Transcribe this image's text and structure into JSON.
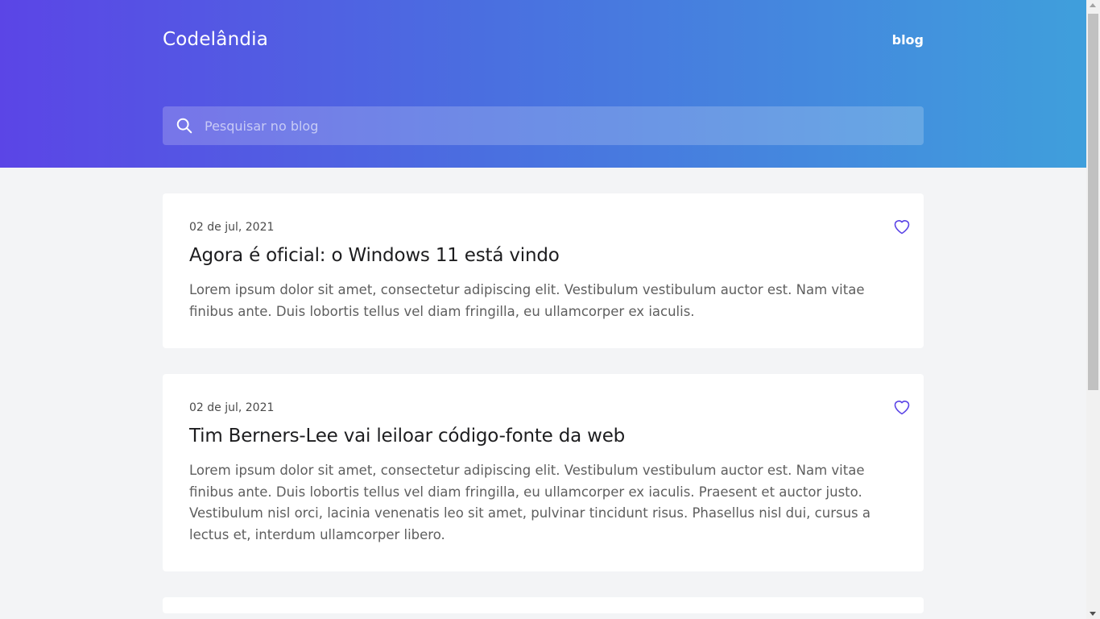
{
  "header": {
    "logo": "Codelândia",
    "nav_link": "blog",
    "search_placeholder": "Pesquisar no blog"
  },
  "posts": [
    {
      "date": "02 de jul, 2021",
      "title": "Agora é oficial: o Windows 11 está vindo",
      "body": "Lorem ipsum dolor sit amet, consectetur adipiscing elit. Vestibulum vestibulum auctor est. Nam vitae finibus ante. Duis lobortis tellus vel diam fringilla, eu ullamcorper ex iaculis."
    },
    {
      "date": "02 de jul, 2021",
      "title": "Tim Berners-Lee vai leiloar código-fonte da web",
      "body": "Lorem ipsum dolor sit amet, consectetur adipiscing elit. Vestibulum vestibulum auctor est. Nam vitae finibus ante. Duis lobortis tellus vel diam fringilla, eu ullamcorper ex iaculis. Praesent et auctor justo. Vestibulum nisl orci, lacinia venenatis leo sit amet, pulvinar tincidunt risus. Phasellus nisl dui, cursus a lectus et, interdum ullamcorper libero."
    }
  ],
  "icons": {
    "search": "search-icon",
    "like": "heart-icon"
  },
  "colors": {
    "accent": "#5b45e6",
    "gradient_end": "#3f9fdc",
    "background": "#f3f4f6"
  }
}
